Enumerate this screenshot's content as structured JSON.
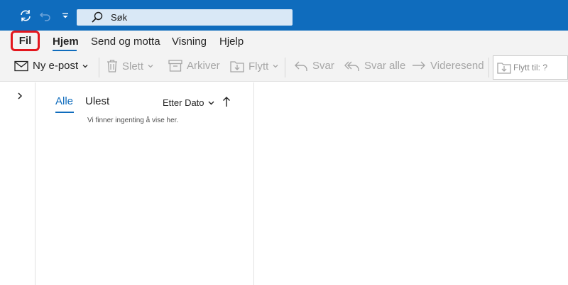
{
  "search": {
    "placeholder": "Søk"
  },
  "menu": {
    "file": "Fil",
    "tabs": [
      "Hjem",
      "Send og motta",
      "Visning",
      "Hjelp"
    ]
  },
  "ribbon": {
    "new_mail": "Ny e-post",
    "delete": "Slett",
    "archive": "Arkiver",
    "move": "Flytt",
    "reply": "Svar",
    "reply_all": "Svar alle",
    "forward": "Videresend",
    "move_to": "Flytt til: ?"
  },
  "list": {
    "filter_all": "Alle",
    "filter_unread": "Ulest",
    "sort_label": "Etter Dato",
    "empty_message": "Vi finner ingenting å vise her."
  },
  "colors": {
    "accent": "#0f6cbd",
    "highlight": "#e3161d"
  },
  "icons": [
    "sync-icon",
    "undo-icon",
    "quick-access-dropdown-icon",
    "search-icon",
    "mail-icon",
    "trash-icon",
    "archive-icon",
    "move-folder-icon",
    "reply-icon",
    "reply-all-icon",
    "forward-icon",
    "folder-move-icon",
    "chevron-right-icon",
    "chevron-down-icon",
    "arrow-up-icon"
  ]
}
